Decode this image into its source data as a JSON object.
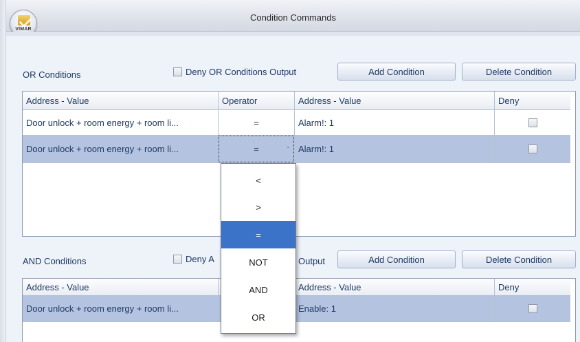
{
  "window": {
    "title": "Condition Commands",
    "logo_text": "VIMAR"
  },
  "or_section": {
    "label": "OR Conditions",
    "deny_label": "Deny OR Conditions Output",
    "add_button": "Add Condition",
    "delete_button": "Delete Condition",
    "columns": [
      "Address - Value",
      "Operator",
      "Address - Value",
      "Deny"
    ],
    "rows": [
      {
        "address1": "Door unlock + room energy + room li...",
        "operator": "=",
        "address2": "Alarm!: 1"
      },
      {
        "address1": "Door unlock + room energy + room li...",
        "operator": "=",
        "address2": "Alarm!: 1"
      }
    ]
  },
  "and_section": {
    "label": "AND Conditions",
    "deny_label_visible": "Deny A",
    "deny_label_tail": "Output",
    "add_button": "Add Condition",
    "delete_button": "Delete Condition",
    "columns": [
      "Address - Value",
      "Address - Value",
      "Deny"
    ],
    "rows": [
      {
        "address1": "Door unlock + room energy + room li...",
        "address2": "Enable: 1"
      }
    ]
  },
  "operator_dropdown": {
    "options": [
      "<",
      ">",
      "=",
      "NOT",
      "AND",
      "OR"
    ],
    "selected": "="
  },
  "colors": {
    "selected_row": "#b4c4e0",
    "dropdown_highlight": "#3b73c9",
    "text": "#1e3a66"
  }
}
